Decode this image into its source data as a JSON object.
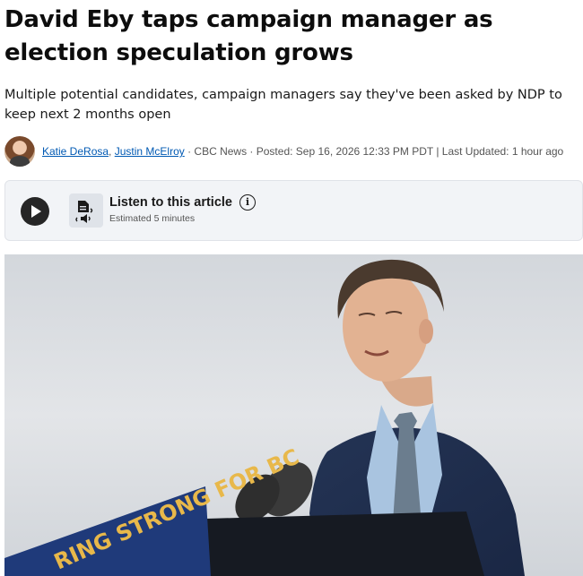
{
  "article": {
    "headline": "David Eby taps campaign manager as election speculation grows",
    "deck": "Multiple potential candidates, campaign managers say they've been asked by NDP to keep next 2 months open"
  },
  "byline": {
    "authors": [
      "Katie DeRosa",
      "Justin McElroy"
    ],
    "separator_authors": ", ",
    "source": " · CBC News · Posted: Sep 16, 2026 12:33 PM PDT | Last Updated: 1 hour ago"
  },
  "listen": {
    "title": "Listen to this article",
    "estimate": "Estimated 5 minutes",
    "play_icon": "play-icon",
    "tts_icon": "text-to-speech-icon",
    "info_icon": "info-icon"
  },
  "photo": {
    "sign_text": "RING STRONG FOR BC"
  },
  "colors": {
    "link": "#0059b3",
    "listen_bg": "#f2f4f7",
    "sign_blue": "#1f3a7a",
    "sign_gold": "#e8b84a"
  }
}
